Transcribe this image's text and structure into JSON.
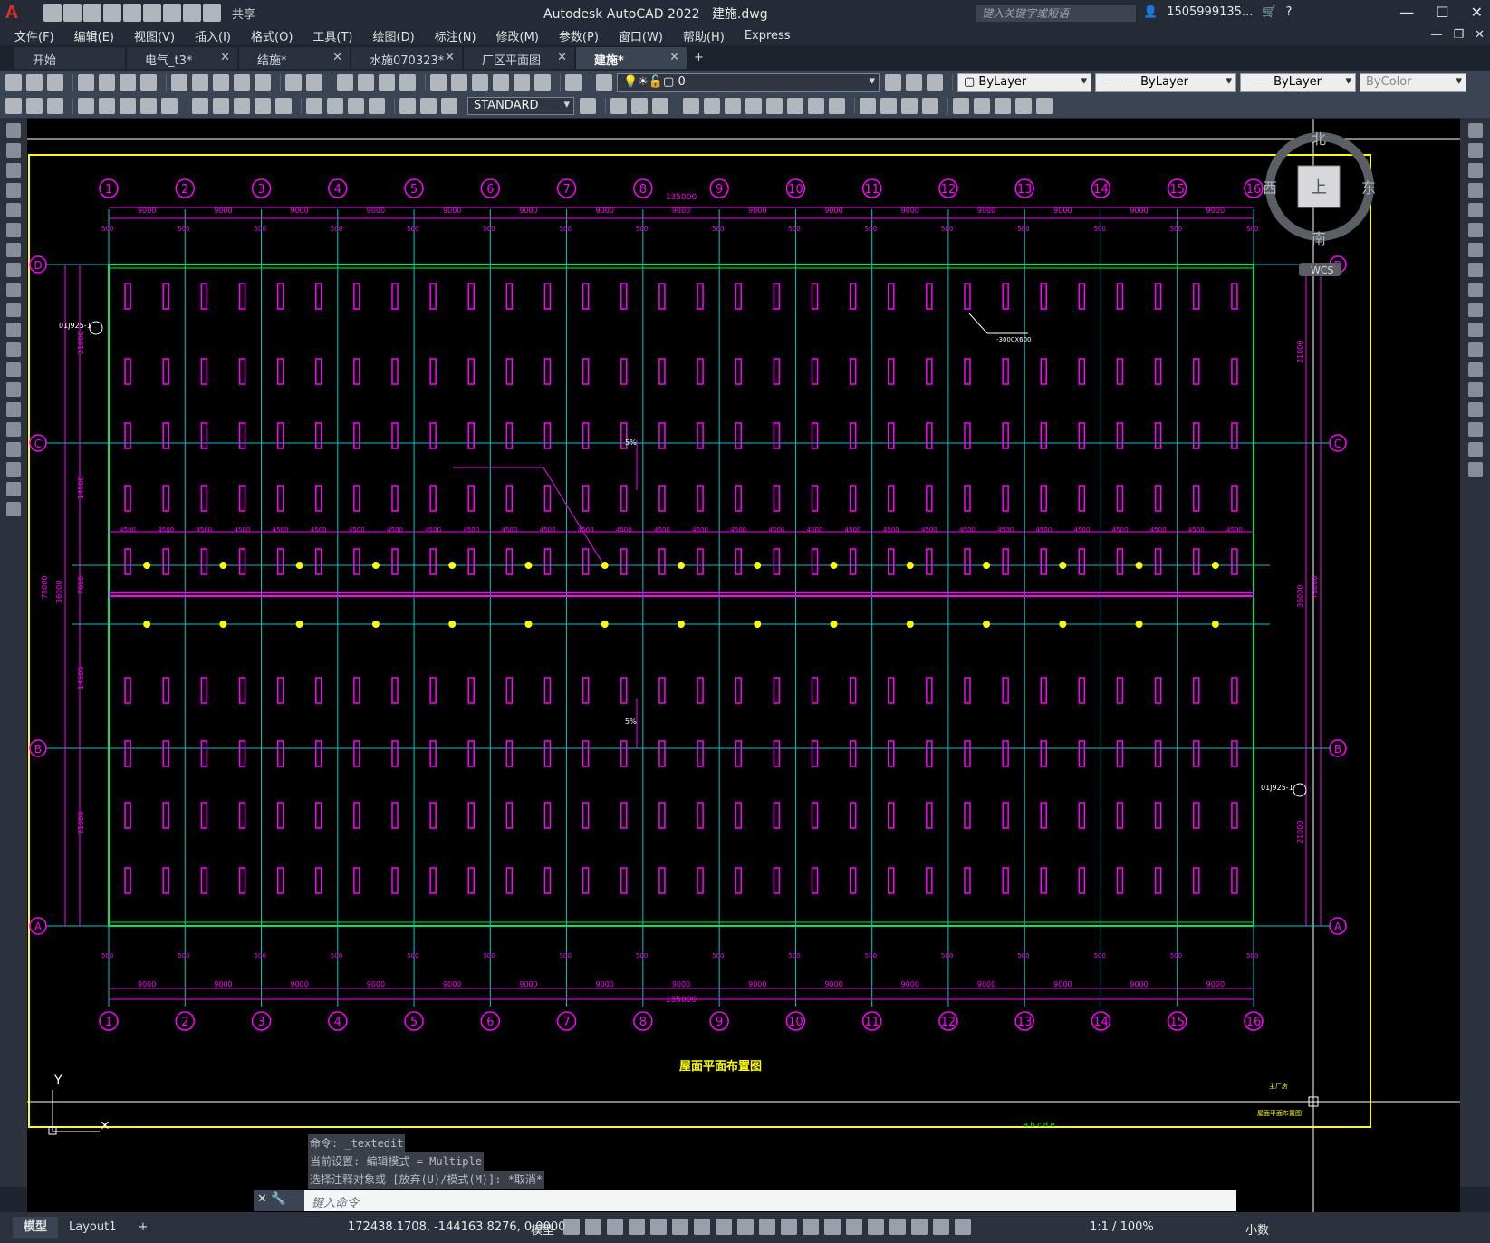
{
  "app": {
    "title": "Autodesk AutoCAD 2022",
    "document": "建施.dwg",
    "search_placeholder": "键入关键字或短语",
    "user": "1505999135...",
    "share": "共享"
  },
  "menu": [
    "文件(F)",
    "编辑(E)",
    "视图(V)",
    "插入(I)",
    "格式(O)",
    "工具(T)",
    "绘图(D)",
    "标注(N)",
    "修改(M)",
    "参数(P)",
    "窗口(W)",
    "帮助(H)",
    "Express"
  ],
  "tabs": [
    {
      "label": "开始",
      "closable": false,
      "active": false
    },
    {
      "label": "电气_t3*",
      "closable": true,
      "active": false
    },
    {
      "label": "结施*",
      "closable": true,
      "active": false
    },
    {
      "label": "水施070323*",
      "closable": true,
      "active": false
    },
    {
      "label": "厂区平面图",
      "closable": true,
      "active": false
    },
    {
      "label": "建施*",
      "closable": true,
      "active": true
    }
  ],
  "toolbar": {
    "layer": "0",
    "color": "ByLayer",
    "linetype": "ByLayer",
    "lineweight": "ByLayer",
    "plotstyle": "ByColor",
    "textstyle": "STANDARD"
  },
  "viewcube": {
    "north": "北",
    "south": "南",
    "east": "东",
    "west": "西",
    "top": "上",
    "wcs": "WCS"
  },
  "drawing": {
    "grid_cols": [
      "1",
      "2",
      "3",
      "4",
      "5",
      "6",
      "7",
      "8",
      "9",
      "10",
      "11",
      "12",
      "13",
      "14",
      "15",
      "16"
    ],
    "grid_rows": [
      "D",
      "C",
      "B",
      "A"
    ],
    "total_dim": "135000",
    "bay_dim": "9000",
    "half_bay_dim": "4500",
    "small_dim": "500",
    "left_dims": [
      "21000",
      "14500",
      "7600",
      "14500",
      "21000"
    ],
    "overall_depth": "78000",
    "center_depth": "36000",
    "detail_ref_left": "01J925-1",
    "detail_ref_right": "01J925-1",
    "note_size": "-3000X600",
    "slope": "5%",
    "drawing_title": "屋面平面布置图",
    "axis_y": "Y",
    "titleblock_project": "主厂房",
    "titleblock_name": "屋面平面布置图",
    "scale_letters": "a b c d e"
  },
  "command": {
    "history": [
      "命令: _textedit",
      "当前设置: 编辑模式 = Multiple",
      "选择注释对象或 [放弃(U)/模式(M)]: *取消*"
    ],
    "placeholder": "键入命令"
  },
  "status": {
    "model_tab": "模型",
    "layout_tab": "Layout1",
    "coords": "172438.1708, -144163.8276, 0.0000",
    "mode": "模型",
    "scale": "1:1 / 100%",
    "units": "小数"
  },
  "colors": {
    "grid_line": "#00c8c8",
    "dim": "#ff00ff",
    "wall": "#00ff00",
    "border": "#ffff00",
    "column": "#ffff00"
  }
}
